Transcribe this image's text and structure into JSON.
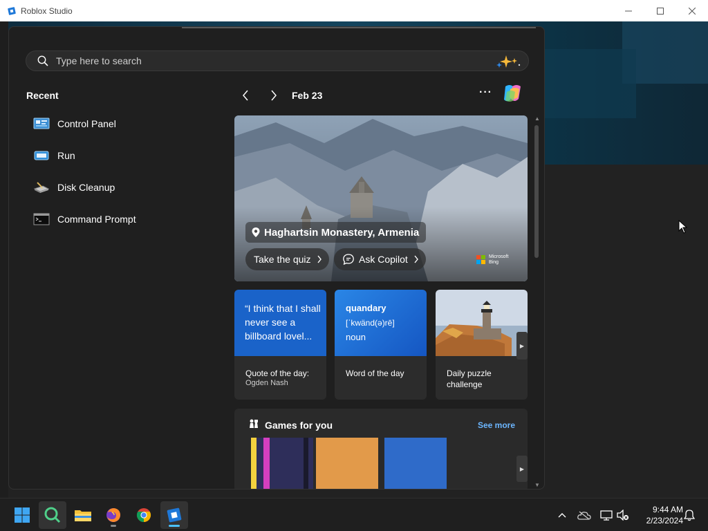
{
  "window": {
    "title": "Roblox Studio",
    "controls": [
      "minimize",
      "maximize",
      "close"
    ]
  },
  "search": {
    "placeholder": "Type here to search"
  },
  "recent": {
    "title": "Recent",
    "items": [
      {
        "label": "Control Panel",
        "icon": "control-panel-icon"
      },
      {
        "label": "Run",
        "icon": "run-icon"
      },
      {
        "label": "Disk Cleanup",
        "icon": "disk-cleanup-icon"
      },
      {
        "label": "Command Prompt",
        "icon": "command-prompt-icon"
      }
    ]
  },
  "feed": {
    "date": "Feb 23",
    "more": "···",
    "hero": {
      "location": "Haghartsin Monastery, Armenia",
      "quiz_button": "Take the quiz",
      "copilot_button": "Ask Copilot",
      "bing_label": [
        "Microsoft",
        "Bing"
      ]
    },
    "cards": {
      "quote": {
        "text": "“I think that I shall never see a billboard lovel...",
        "caption": "Quote of the day:",
        "author": "Ogden Nash",
        "color": "#1a63c9"
      },
      "word": {
        "word": "quandary",
        "pronunciation": "[ˈkwänd(ə)rē]",
        "part_of_speech": "noun",
        "caption": "Word of the day",
        "color": "#1b6fd6"
      },
      "puzzle": {
        "caption_line1": "Daily puzzle",
        "caption_line2": "challenge"
      }
    },
    "games": {
      "title": "Games for you",
      "see_more": "See more",
      "tiles": [
        "#2e2e5a",
        "#e29a4a",
        "#2f6bc9"
      ]
    }
  },
  "taskbar": {
    "apps": [
      "windows-start-icon",
      "search-app-icon",
      "file-explorer-icon",
      "firefox-icon",
      "chrome-icon",
      "roblox-studio-icon"
    ],
    "time": "9:44 AM",
    "date": "2/23/2024"
  }
}
